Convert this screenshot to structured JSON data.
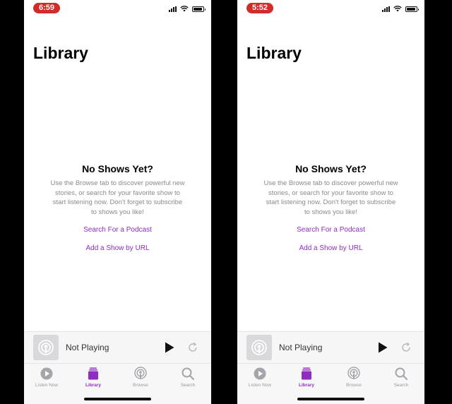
{
  "colors": {
    "accent": "#8e2dbf",
    "time_pill": "#d32a2a"
  },
  "screens": [
    {
      "status": {
        "time": "6:59"
      },
      "title": "Library",
      "empty_title": "No Shows Yet?",
      "empty_lines": [
        "Use the Browse tab to discover powerful new",
        "stories, or search for your favorite show to",
        "start listening now. Don't forget to subscribe",
        "to shows you like!"
      ],
      "search_link": "Search For a Podcast",
      "url_link": "Add a Show by URL",
      "player": {
        "label": "Not Playing",
        "play_icon": "play-icon",
        "refresh_icon": "skip-forward-icon"
      },
      "tabs": [
        {
          "label": "Listen Now",
          "icon": "play-circle-icon"
        },
        {
          "label": "Library",
          "icon": "library-icon"
        },
        {
          "label": "Browse",
          "icon": "podcast-icon"
        },
        {
          "label": "Search",
          "icon": "search-icon"
        }
      ]
    },
    {
      "status": {
        "time": "5:52"
      },
      "title": "Library",
      "empty_title": "No Shows Yet?",
      "empty_lines": [
        "Use the Browse tab to discover powerful new",
        "stories, or search for your favorite show to",
        "start listening now. Don't forget to subscribe",
        "to shows you like!"
      ],
      "search_link": "Search For a Podcast",
      "url_link": "Add a Show by URL",
      "player": {
        "label": "Not Playing",
        "play_icon": "play-icon",
        "refresh_icon": "skip-forward-icon"
      },
      "tabs": [
        {
          "label": "Listen Now",
          "icon": "play-circle-icon"
        },
        {
          "label": "Library",
          "icon": "library-icon"
        },
        {
          "label": "Browse",
          "icon": "podcast-icon"
        },
        {
          "label": "Search",
          "icon": "search-icon"
        }
      ]
    }
  ]
}
